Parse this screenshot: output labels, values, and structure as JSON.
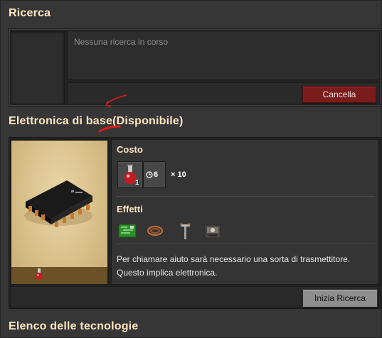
{
  "research": {
    "title": "Ricerca",
    "status": "Nessuna ricerca in corso",
    "cancel_label": "Cancella"
  },
  "technology": {
    "title": "Elettronica di base(Disponibile)",
    "cost_title": "Costo",
    "cost": {
      "ingredient_icon": "red-science-flask-icon",
      "ingredient_count": "1",
      "time": "6",
      "multiplier": "× 10"
    },
    "effects_title": "Effetti",
    "effects": [
      {
        "icon": "circuit-board-icon"
      },
      {
        "icon": "copper-wire-icon"
      },
      {
        "icon": "small-pole-icon"
      },
      {
        "icon": "machine-icon"
      }
    ],
    "description": "Per chiamare aiuto sarà necessario una sorta di trasmettitore. Questo implica elettronica.",
    "start_label": "Inizia Ricerca"
  },
  "tech_list": {
    "title": "Elenco delle tecnologie"
  },
  "colors": {
    "title": "#ffe6c0",
    "cancel_button": "#7b1c1c",
    "start_button": "#8e8e8e",
    "annotation": "#e01a1a"
  }
}
